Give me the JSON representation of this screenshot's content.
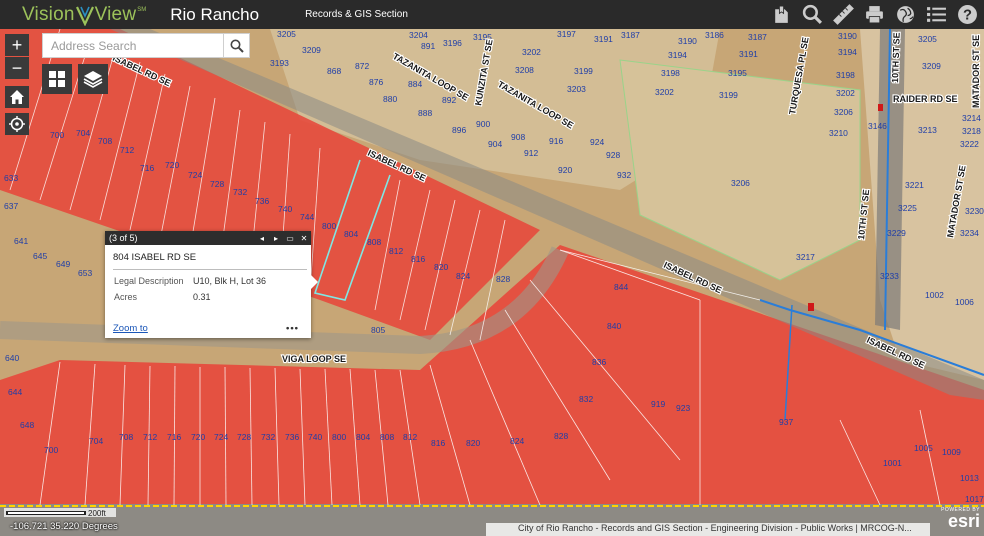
{
  "header": {
    "logo_vision": "Vision",
    "logo_view": "View",
    "logo_tm": "SM",
    "city": "Rio Rancho",
    "section": "Records & GIS Section",
    "tools": [
      "bookmark-icon",
      "search-icon",
      "measure-icon",
      "print-icon",
      "basemap-gallery-icon",
      "legend-list-icon",
      "help-icon"
    ]
  },
  "map": {
    "search_placeholder": "Address Search",
    "zoom_in": "+",
    "zoom_out": "−",
    "streets": {
      "tazanita_loop": "TAZANITA LOOP SE",
      "tazanita_loop_2": "TAZANITA LOOP SE",
      "kunzita": "KUNZITA ST SE",
      "isabel_1": "ISABEL RD SE",
      "isabel_2": "ISABEL RD SE",
      "isabel_3": "ISABEL RD SE",
      "isabel_4": "ISABEL RD SE",
      "viga_loop": "VIGA LOOP SE",
      "turquesa": "TURQUESA PL SE",
      "tenth_1": "10TH ST SE",
      "tenth_2": "10TH ST SE",
      "raider": "RAIDER RD SE",
      "matador_1": "MATADOR ST SE",
      "matador_2": "MATADOR ST SE"
    },
    "parcel_numbers": {
      "upper_left": [
        "700",
        "704",
        "708",
        "712",
        "716",
        "720",
        "724",
        "728",
        "732",
        "736",
        "740",
        "744",
        "800"
      ],
      "highlight_row": [
        "804",
        "808",
        "812",
        "816",
        "820",
        "824",
        "828"
      ],
      "east_block": [
        "844",
        "840",
        "836",
        "832",
        "919",
        "923",
        "937"
      ],
      "bottom_row": [
        "700",
        "704",
        "708",
        "712",
        "716",
        "720",
        "724",
        "728",
        "732",
        "736",
        "740",
        "800",
        "804",
        "808",
        "812",
        "816",
        "820",
        "824",
        "828"
      ],
      "left_edge": [
        "656",
        "633",
        "637",
        "641",
        "645",
        "649",
        "653",
        "640",
        "644",
        "648"
      ],
      "misc": [
        "805",
        "1001",
        "1005",
        "1009",
        "1013",
        "1017",
        "1002",
        "1006"
      ],
      "north": [
        "3205",
        "3209",
        "3193",
        "868",
        "872",
        "876",
        "880",
        "884",
        "888",
        "892",
        "896",
        "900",
        "904",
        "908",
        "912",
        "916",
        "920",
        "924",
        "928",
        "932",
        "3204",
        "891",
        "3196",
        "3195",
        "3202",
        "3208",
        "3199",
        "3203",
        "3191",
        "3197",
        "3187",
        "3194",
        "3198",
        "3202",
        "3190",
        "3186",
        "3187",
        "3191",
        "3195",
        "3199",
        "3190",
        "3194",
        "3198",
        "3202",
        "3206",
        "3210",
        "3146",
        "3206",
        "3217",
        "3233",
        "3221",
        "3225",
        "3229",
        "3205",
        "3209",
        "3213",
        "3214",
        "3218",
        "3222",
        "3234",
        "3230"
      ]
    }
  },
  "popup": {
    "counter": "(3 of 5)",
    "prev": "◂",
    "next": "▸",
    "maximize": "▭",
    "close": "✕",
    "title": "804 ISABEL RD SE",
    "rows": [
      {
        "key": "Legal Description",
        "value": "U10, Blk H, Lot 36"
      },
      {
        "key": "Acres",
        "value": "0.31"
      }
    ],
    "zoom_to": "Zoom to",
    "more": "•••"
  },
  "footer": {
    "scale_label": "200ft",
    "coordinates": "-106.721 35.220 Degrees",
    "attribution": "City of Rio Rancho - Records and GIS Section - Engineering Division - Public Works | MRCOG-N...",
    "powered_by": "POWERED BY",
    "esri": "esri"
  },
  "colors": {
    "header_bg": "#2a2a2a",
    "brand_green": "#9cc25a",
    "parcel_red": "#e8493c",
    "highlight_cyan": "#7fe7e4",
    "parcel_label_blue": "#1f3ea8"
  }
}
